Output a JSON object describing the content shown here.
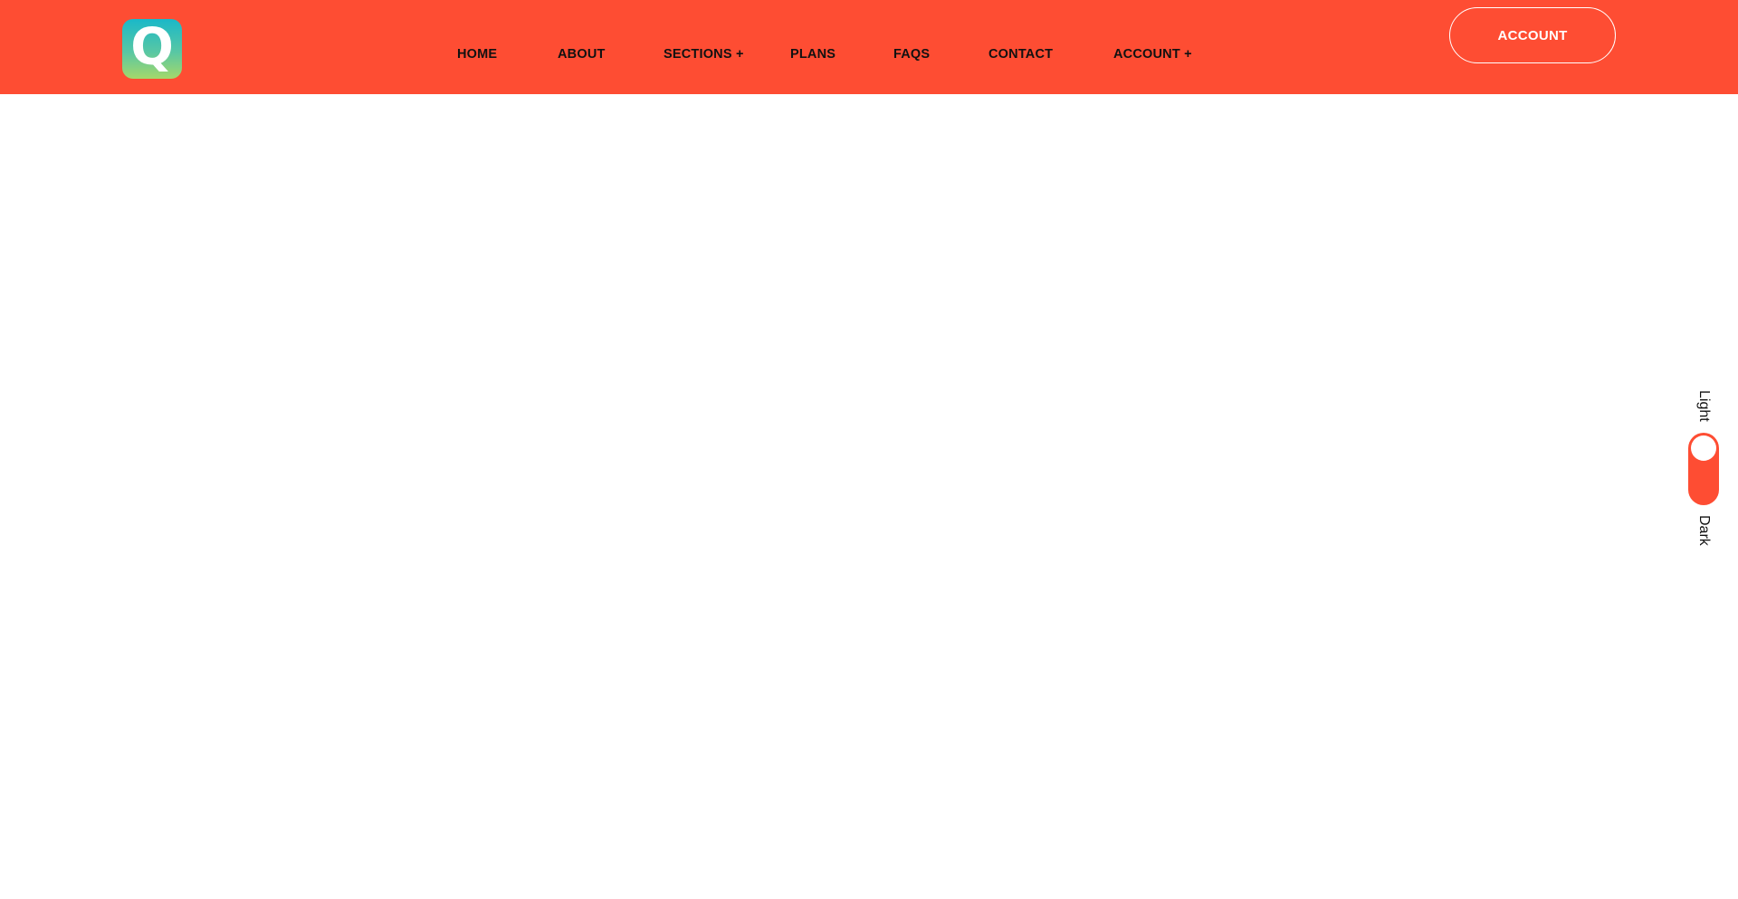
{
  "brand": {
    "logo_letter": "Q",
    "header_color": "#fe4d33",
    "logo_gradient": [
      "#1ab8c9",
      "#58c7a4",
      "#a5d86a"
    ]
  },
  "nav": {
    "items": [
      {
        "label": "HOME"
      },
      {
        "label": "ABOUT"
      },
      {
        "label": "SECTIONS +"
      },
      {
        "label": "PLANS"
      },
      {
        "label": "FAQS"
      },
      {
        "label": "CONTACT"
      },
      {
        "label": "ACCOUNT +"
      }
    ]
  },
  "header": {
    "account_button_label": "ACCOUNT"
  },
  "theme_switch": {
    "light_label": "Light",
    "dark_label": "Dark",
    "selected": "Light"
  }
}
